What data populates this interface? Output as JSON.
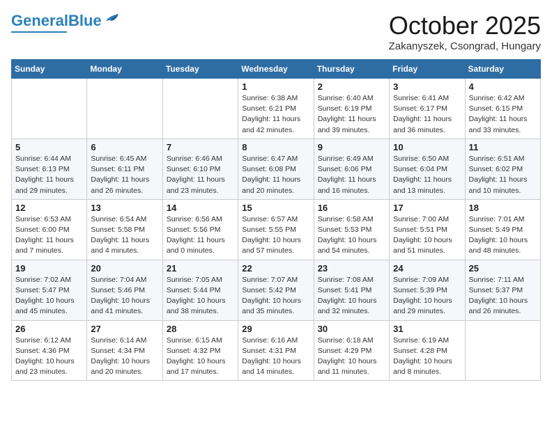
{
  "header": {
    "logo_general": "General",
    "logo_blue": "Blue",
    "month_title": "October 2025",
    "location": "Zakanyszek, Csongrad, Hungary"
  },
  "weekdays": [
    "Sunday",
    "Monday",
    "Tuesday",
    "Wednesday",
    "Thursday",
    "Friday",
    "Saturday"
  ],
  "weeks": [
    [
      {
        "day": "",
        "info": ""
      },
      {
        "day": "",
        "info": ""
      },
      {
        "day": "",
        "info": ""
      },
      {
        "day": "1",
        "info": "Sunrise: 6:38 AM\nSunset: 6:21 PM\nDaylight: 11 hours\nand 42 minutes."
      },
      {
        "day": "2",
        "info": "Sunrise: 6:40 AM\nSunset: 6:19 PM\nDaylight: 11 hours\nand 39 minutes."
      },
      {
        "day": "3",
        "info": "Sunrise: 6:41 AM\nSunset: 6:17 PM\nDaylight: 11 hours\nand 36 minutes."
      },
      {
        "day": "4",
        "info": "Sunrise: 6:42 AM\nSunset: 6:15 PM\nDaylight: 11 hours\nand 33 minutes."
      }
    ],
    [
      {
        "day": "5",
        "info": "Sunrise: 6:44 AM\nSunset: 6:13 PM\nDaylight: 11 hours\nand 29 minutes."
      },
      {
        "day": "6",
        "info": "Sunrise: 6:45 AM\nSunset: 6:11 PM\nDaylight: 11 hours\nand 26 minutes."
      },
      {
        "day": "7",
        "info": "Sunrise: 6:46 AM\nSunset: 6:10 PM\nDaylight: 11 hours\nand 23 minutes."
      },
      {
        "day": "8",
        "info": "Sunrise: 6:47 AM\nSunset: 6:08 PM\nDaylight: 11 hours\nand 20 minutes."
      },
      {
        "day": "9",
        "info": "Sunrise: 6:49 AM\nSunset: 6:06 PM\nDaylight: 11 hours\nand 16 minutes."
      },
      {
        "day": "10",
        "info": "Sunrise: 6:50 AM\nSunset: 6:04 PM\nDaylight: 11 hours\nand 13 minutes."
      },
      {
        "day": "11",
        "info": "Sunrise: 6:51 AM\nSunset: 6:02 PM\nDaylight: 11 hours\nand 10 minutes."
      }
    ],
    [
      {
        "day": "12",
        "info": "Sunrise: 6:53 AM\nSunset: 6:00 PM\nDaylight: 11 hours\nand 7 minutes."
      },
      {
        "day": "13",
        "info": "Sunrise: 6:54 AM\nSunset: 5:58 PM\nDaylight: 11 hours\nand 4 minutes."
      },
      {
        "day": "14",
        "info": "Sunrise: 6:56 AM\nSunset: 5:56 PM\nDaylight: 11 hours\nand 0 minutes."
      },
      {
        "day": "15",
        "info": "Sunrise: 6:57 AM\nSunset: 5:55 PM\nDaylight: 10 hours\nand 57 minutes."
      },
      {
        "day": "16",
        "info": "Sunrise: 6:58 AM\nSunset: 5:53 PM\nDaylight: 10 hours\nand 54 minutes."
      },
      {
        "day": "17",
        "info": "Sunrise: 7:00 AM\nSunset: 5:51 PM\nDaylight: 10 hours\nand 51 minutes."
      },
      {
        "day": "18",
        "info": "Sunrise: 7:01 AM\nSunset: 5:49 PM\nDaylight: 10 hours\nand 48 minutes."
      }
    ],
    [
      {
        "day": "19",
        "info": "Sunrise: 7:02 AM\nSunset: 5:47 PM\nDaylight: 10 hours\nand 45 minutes."
      },
      {
        "day": "20",
        "info": "Sunrise: 7:04 AM\nSunset: 5:46 PM\nDaylight: 10 hours\nand 41 minutes."
      },
      {
        "day": "21",
        "info": "Sunrise: 7:05 AM\nSunset: 5:44 PM\nDaylight: 10 hours\nand 38 minutes."
      },
      {
        "day": "22",
        "info": "Sunrise: 7:07 AM\nSunset: 5:42 PM\nDaylight: 10 hours\nand 35 minutes."
      },
      {
        "day": "23",
        "info": "Sunrise: 7:08 AM\nSunset: 5:41 PM\nDaylight: 10 hours\nand 32 minutes."
      },
      {
        "day": "24",
        "info": "Sunrise: 7:09 AM\nSunset: 5:39 PM\nDaylight: 10 hours\nand 29 minutes."
      },
      {
        "day": "25",
        "info": "Sunrise: 7:11 AM\nSunset: 5:37 PM\nDaylight: 10 hours\nand 26 minutes."
      }
    ],
    [
      {
        "day": "26",
        "info": "Sunrise: 6:12 AM\nSunset: 4:36 PM\nDaylight: 10 hours\nand 23 minutes."
      },
      {
        "day": "27",
        "info": "Sunrise: 6:14 AM\nSunset: 4:34 PM\nDaylight: 10 hours\nand 20 minutes."
      },
      {
        "day": "28",
        "info": "Sunrise: 6:15 AM\nSunset: 4:32 PM\nDaylight: 10 hours\nand 17 minutes."
      },
      {
        "day": "29",
        "info": "Sunrise: 6:16 AM\nSunset: 4:31 PM\nDaylight: 10 hours\nand 14 minutes."
      },
      {
        "day": "30",
        "info": "Sunrise: 6:18 AM\nSunset: 4:29 PM\nDaylight: 10 hours\nand 11 minutes."
      },
      {
        "day": "31",
        "info": "Sunrise: 6:19 AM\nSunset: 4:28 PM\nDaylight: 10 hours\nand 8 minutes."
      },
      {
        "day": "",
        "info": ""
      }
    ]
  ]
}
